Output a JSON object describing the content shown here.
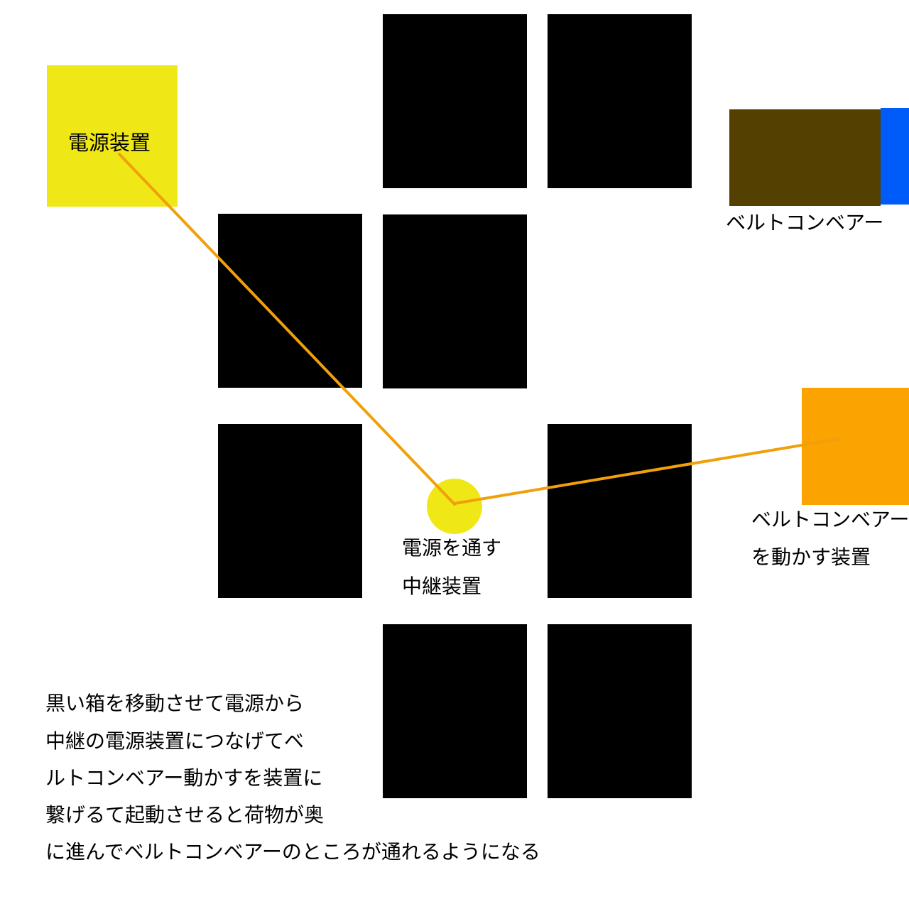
{
  "power_source": {
    "label": "電源装置",
    "color": "#f0e816"
  },
  "relay": {
    "lines": [
      "電源を通す",
      "中継装置"
    ],
    "color": "#f0e816"
  },
  "conveyor": {
    "label": "ベルトコンベアー",
    "belt_color": "#544000",
    "end_color": "#005cf8"
  },
  "conveyor_driver": {
    "lines": [
      "ベルトコンベアー",
      "を動かす装置"
    ],
    "color": "#fba300"
  },
  "wire_color": "#f0a00a",
  "box_color": "#000000",
  "description": [
    "黒い箱を移動させて電源から",
    "中継の電源装置につなげてベ",
    "ルトコンベアー動かすを装置に",
    "繋げるて起動させると荷物が奥",
    "に進んでベルトコンベアーのところが通れるようになる"
  ]
}
